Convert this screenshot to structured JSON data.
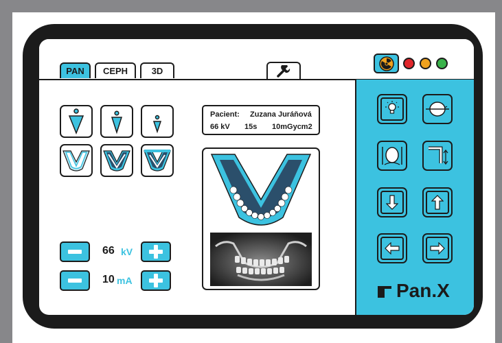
{
  "tabs": [
    {
      "label": "PAN",
      "active": true
    },
    {
      "label": "CEPH",
      "active": false
    },
    {
      "label": "3D",
      "active": false
    }
  ],
  "toolbar": {
    "settings_icon": "wrench-icon",
    "radiation_icon": "radiation-icon",
    "status_lights": [
      {
        "name": "red",
        "color": "#e0262b"
      },
      {
        "name": "yellow",
        "color": "#f0a21e"
      },
      {
        "name": "green",
        "color": "#39b24a"
      }
    ]
  },
  "patient": {
    "label": "Pacient:",
    "name": "Zuzana Juráňová",
    "kv": "66 kV",
    "time": "15s",
    "dose": "10mGycm2"
  },
  "exposure": {
    "kv_value": "66",
    "kv_unit": "kV",
    "ma_value": "10",
    "ma_unit": "mA"
  },
  "mode_buttons": {
    "patient_size": [
      "patient-large-icon",
      "patient-medium-icon",
      "patient-small-icon"
    ],
    "arch_shape": [
      "arch-wide-icon",
      "arch-medium-icon",
      "arch-narrow-icon"
    ]
  },
  "controls": [
    "light-bulb-icon",
    "head-sagittal-icon",
    "head-frontal-icon",
    "column-height-icon",
    "arrow-down-icon",
    "arrow-up-icon",
    "arrow-left-icon",
    "arrow-right-icon"
  ],
  "brand": {
    "name": "Pan.X"
  },
  "colors": {
    "accent": "#3cc2e0",
    "dark": "#1b1b1b",
    "frame": "#87878a"
  }
}
